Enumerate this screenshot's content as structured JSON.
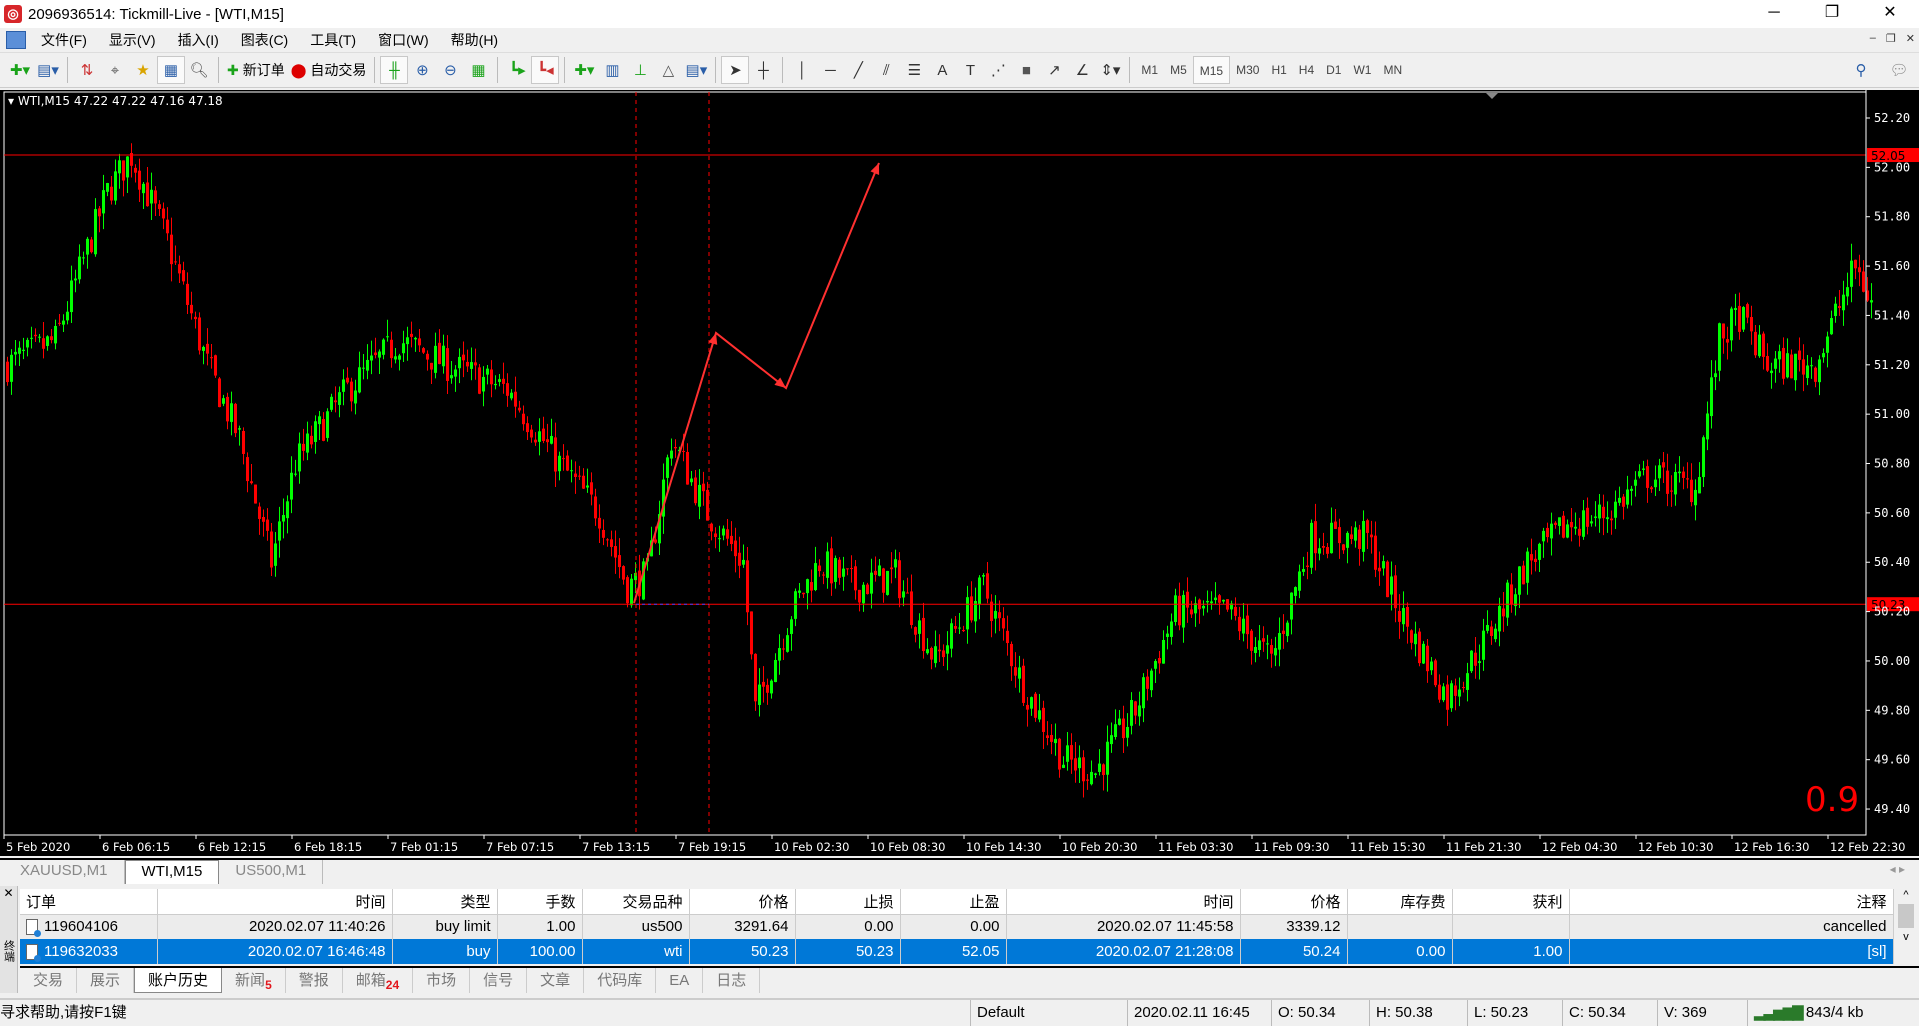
{
  "window": {
    "title": "2096936514: Tickmill-Live - [WTI,M15]",
    "controls": [
      "─",
      "❐",
      "✕"
    ]
  },
  "menu": [
    "文件(F)",
    "显示(V)",
    "插入(I)",
    "图表(C)",
    "工具(T)",
    "窗口(W)",
    "帮助(H)"
  ],
  "toolbar": {
    "new_order": "新订单",
    "auto_trading": "自动交易",
    "timeframes": [
      "M1",
      "M5",
      "M15",
      "M30",
      "H1",
      "H4",
      "D1",
      "W1",
      "MN"
    ],
    "active_timeframe": "M15"
  },
  "chart": {
    "header": "WTI,M15  47.22 47.22 47.16 47.18",
    "overlay_text": "0.9",
    "colors": {
      "bull": "#00ff00",
      "bear": "#ff0000",
      "bg": "#000000",
      "lines": "#ff0000"
    }
  },
  "chart_data": {
    "type": "candlestick",
    "symbol": "WTI",
    "timeframe": "M15",
    "ylim": [
      49.33,
      52.3
    ],
    "y_ticks": [
      "52.20",
      "52.00",
      "51.80",
      "51.60",
      "51.40",
      "51.20",
      "51.00",
      "50.80",
      "50.60",
      "50.40",
      "50.20",
      "50.00",
      "49.80",
      "49.60",
      "49.40"
    ],
    "x_ticks": [
      "5 Feb 2020",
      "6 Feb 06:15",
      "6 Feb 12:15",
      "6 Feb 18:15",
      "7 Feb 01:15",
      "7 Feb 07:15",
      "7 Feb 13:15",
      "7 Feb 19:15",
      "10 Feb 02:30",
      "10 Feb 08:30",
      "10 Feb 14:30",
      "10 Feb 20:30",
      "11 Feb 03:30",
      "11 Feb 09:30",
      "11 Feb 15:30",
      "11 Feb 21:30",
      "12 Feb 04:30",
      "12 Feb 10:30",
      "12 Feb 16:30",
      "12 Feb 22:30"
    ],
    "bars_per_tick": 24,
    "approx_close_path": [
      [
        0,
        51.2
      ],
      [
        12,
        51.3
      ],
      [
        25,
        51.9
      ],
      [
        31,
        52.05
      ],
      [
        40,
        51.7
      ],
      [
        50,
        51.2
      ],
      [
        58,
        50.9
      ],
      [
        66,
        50.4
      ],
      [
        72,
        50.8
      ],
      [
        85,
        51.1
      ],
      [
        98,
        51.3
      ],
      [
        110,
        51.2
      ],
      [
        125,
        51.1
      ],
      [
        138,
        50.8
      ],
      [
        148,
        50.6
      ],
      [
        155,
        50.3
      ],
      [
        160,
        50.35
      ],
      [
        166,
        50.9
      ],
      [
        175,
        50.6
      ],
      [
        184,
        50.4
      ],
      [
        187,
        49.8
      ],
      [
        196,
        50.2
      ],
      [
        203,
        50.4
      ],
      [
        212,
        50.3
      ],
      [
        222,
        50.35
      ],
      [
        232,
        50.0
      ],
      [
        244,
        50.3
      ],
      [
        254,
        49.9
      ],
      [
        264,
        49.6
      ],
      [
        272,
        49.55
      ],
      [
        282,
        49.8
      ],
      [
        292,
        50.2
      ],
      [
        305,
        50.2
      ],
      [
        316,
        50.0
      ],
      [
        326,
        50.5
      ],
      [
        340,
        50.5
      ],
      [
        348,
        50.2
      ],
      [
        360,
        49.85
      ],
      [
        370,
        50.1
      ],
      [
        380,
        50.4
      ],
      [
        390,
        50.55
      ],
      [
        400,
        50.6
      ],
      [
        410,
        50.75
      ],
      [
        422,
        50.7
      ],
      [
        428,
        51.3
      ],
      [
        433,
        51.4
      ],
      [
        440,
        51.2
      ],
      [
        452,
        51.2
      ],
      [
        462,
        51.6
      ],
      [
        466,
        51.45
      ]
    ],
    "horizontal_lines": [
      {
        "price": 52.05,
        "label": "52.05"
      },
      {
        "price": 50.23,
        "label": "50.23"
      }
    ]
  },
  "symbol_tabs": [
    "XAUUSD,M1",
    "WTI,M15",
    "US500,M1"
  ],
  "active_symbol_tab": "WTI,M15",
  "terminal": {
    "side_label": "终端",
    "columns": [
      "订单",
      "时间",
      "类型",
      "手数",
      "交易品种",
      "价格",
      "止损",
      "止盈",
      "时间",
      "价格",
      "库存费",
      "获利",
      "注释"
    ],
    "rows": [
      [
        "119604106",
        "2020.02.07 11:40:26",
        "buy limit",
        "1.00",
        "us500",
        "3291.64",
        "0.00",
        "0.00",
        "2020.02.07 11:45:58",
        "3339.12",
        "",
        "",
        "cancelled"
      ],
      [
        "119632033",
        "2020.02.07 16:46:48",
        "buy",
        "100.00",
        "wti",
        "50.23",
        "50.23",
        "52.05",
        "2020.02.07 21:28:08",
        "50.24",
        "0.00",
        "1.00",
        "[sl]"
      ]
    ],
    "tabs": [
      {
        "label": "交易"
      },
      {
        "label": "展示"
      },
      {
        "label": "账户历史"
      },
      {
        "label": "新闻",
        "badge": "5"
      },
      {
        "label": "警报"
      },
      {
        "label": "邮箱",
        "badge": "24"
      },
      {
        "label": "市场"
      },
      {
        "label": "信号"
      },
      {
        "label": "文章"
      },
      {
        "label": "代码库"
      },
      {
        "label": "EA"
      },
      {
        "label": "日志"
      }
    ],
    "active_tab": "账户历史"
  },
  "status": {
    "help": "寻求帮助,请按F1键",
    "profile": "Default",
    "time": "2020.02.11 16:45",
    "open": "O: 50.34",
    "high": "H: 50.38",
    "low": "L: 50.23",
    "close": "C: 50.34",
    "volume": "V: 369",
    "traffic": "843/4 kb"
  }
}
